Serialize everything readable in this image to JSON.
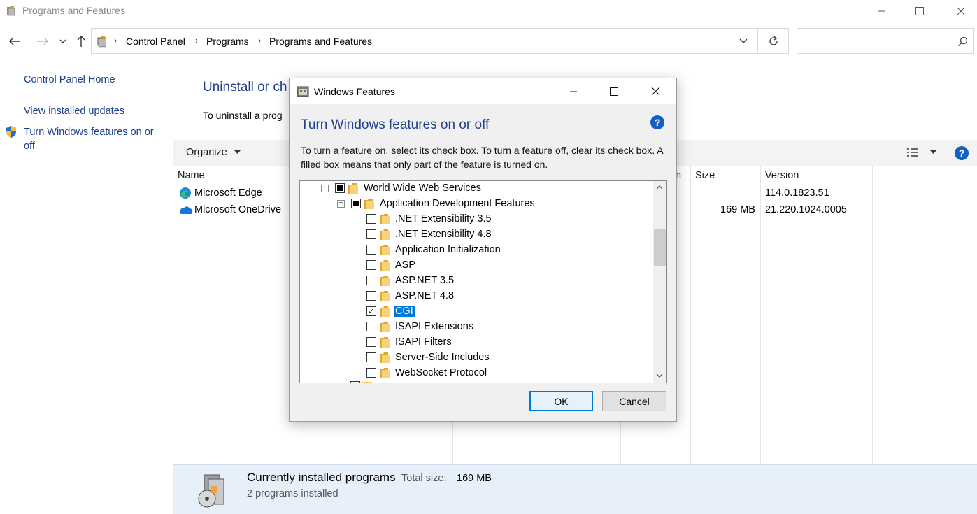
{
  "window": {
    "title": "Programs and Features"
  },
  "address": {
    "crumbs": [
      "Control Panel",
      "Programs",
      "Programs and Features"
    ],
    "search_placeholder": ""
  },
  "left_pane": {
    "home": "Control Panel Home",
    "updates": "View installed updates",
    "features_line1": "Turn Windows features on or",
    "features_line2": "off"
  },
  "main": {
    "heading": "Uninstall or ch",
    "description": "To uninstall a prog",
    "organize": "Organize",
    "columns": {
      "name": "Name",
      "installed_on_fragment": "n",
      "size": "Size",
      "version": "Version"
    },
    "programs": [
      {
        "name": "Microsoft Edge",
        "size": "",
        "version": "114.0.1823.51"
      },
      {
        "name": "Microsoft OneDrive",
        "size": "169 MB",
        "version": "21.220.1024.0005"
      }
    ]
  },
  "status": {
    "title": "Currently installed programs",
    "total_size_label": "Total size:",
    "total_size_value": "169 MB",
    "count": "2 programs installed"
  },
  "dialog": {
    "title": "Windows Features",
    "heading": "Turn Windows features on or off",
    "description": "To turn a feature on, select its check box. To turn a feature off, clear its check box. A filled box means that only part of the feature is turned on.",
    "tree": [
      {
        "label": "World Wide Web Services",
        "state": "partial",
        "expanded": true
      },
      {
        "label": "Application Development Features",
        "state": "partial",
        "expanded": true
      },
      {
        "label": ".NET Extensibility 3.5",
        "state": "unchecked"
      },
      {
        "label": ".NET Extensibility 4.8",
        "state": "unchecked"
      },
      {
        "label": "Application Initialization",
        "state": "unchecked"
      },
      {
        "label": "ASP",
        "state": "unchecked"
      },
      {
        "label": "ASP.NET 3.5",
        "state": "unchecked"
      },
      {
        "label": "ASP.NET 4.8",
        "state": "unchecked"
      },
      {
        "label": "CGI",
        "state": "checked",
        "selected": true
      },
      {
        "label": "ISAPI Extensions",
        "state": "unchecked"
      },
      {
        "label": "ISAPI Filters",
        "state": "unchecked"
      },
      {
        "label": "Server-Side Includes",
        "state": "unchecked"
      },
      {
        "label": "WebSocket Protocol",
        "state": "unchecked"
      }
    ],
    "ok": "OK",
    "cancel": "Cancel",
    "help_glyph": "?"
  },
  "colors": {
    "link": "#1a3f8a",
    "heading": "#1e3d8f",
    "selection": "#0078d7",
    "status_bg": "#e7eff9"
  },
  "icons": [
    "control-panel-icon",
    "edge-icon",
    "onedrive-icon",
    "shield-icon",
    "folder-icon",
    "help-icon",
    "search-icon",
    "refresh-icon"
  ]
}
